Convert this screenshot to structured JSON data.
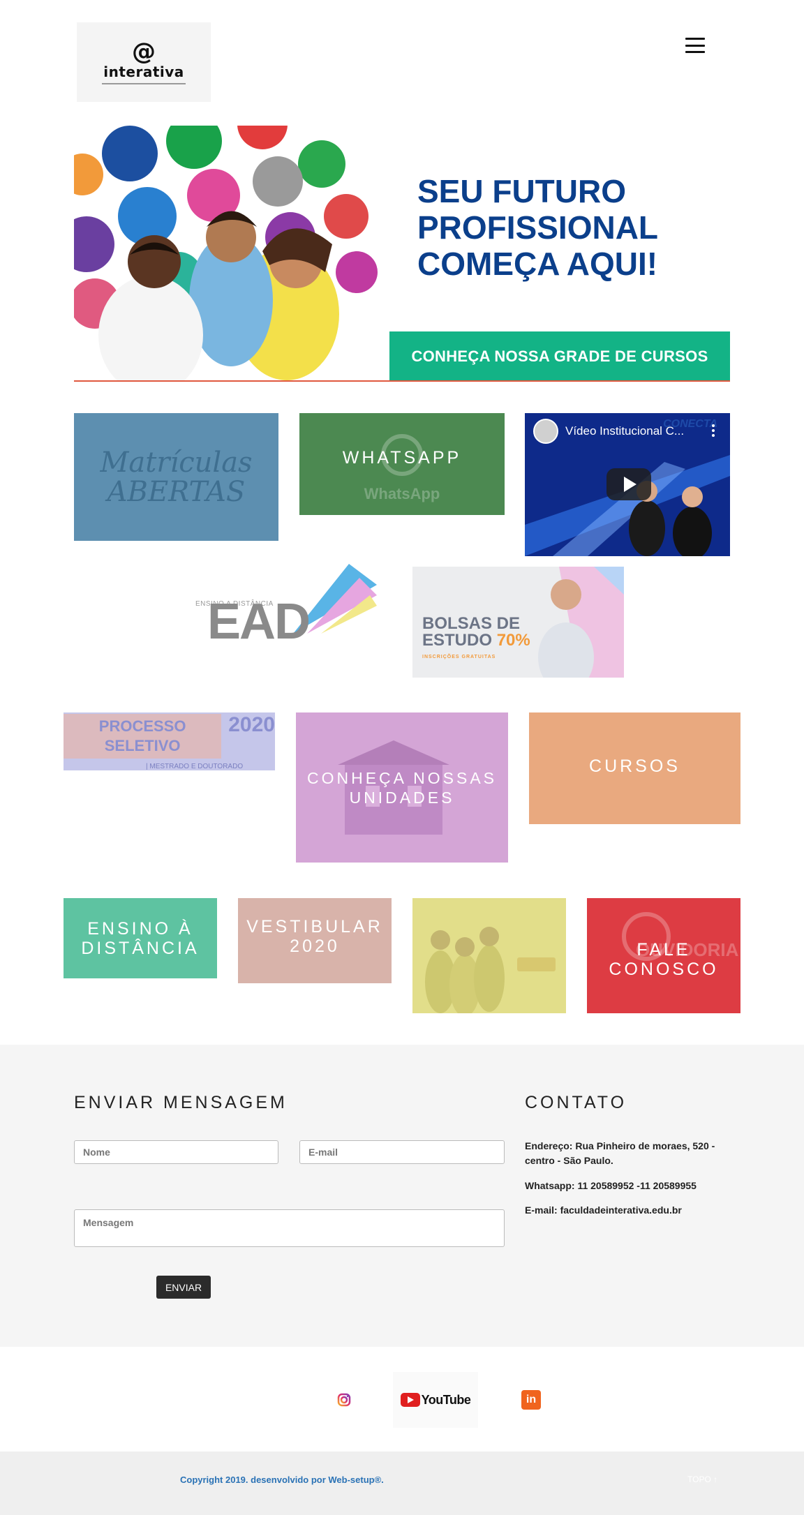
{
  "header": {
    "logo_text": "interativa",
    "logo_at": "@",
    "menu_icon": "hamburger-icon"
  },
  "hero": {
    "headline_line1": "SEU FUTURO",
    "headline_line2": "PROFISSIONAL",
    "headline_line3": "COMEÇA AQUI!",
    "cta": "CONHEÇA NOSSA GRADE DE CURSOS"
  },
  "tiles": {
    "matriculas": "Matrículas\nABERTAS",
    "whatsapp": "WHATSAPP",
    "whatsapp_ghost": "WhatsApp",
    "video_title": "Vídeo Institucional C...",
    "video_brand": "CONECTA",
    "ead_small": "ENSINO A DISTÂNCIA",
    "ead_word": "EAD",
    "bolsas_line1": "BOLSAS DE",
    "bolsas_line2": "ESTUDO",
    "bolsas_pct": "70%",
    "bolsas_sub": "INSCRIÇÕES GRATUITAS",
    "processo": "PROCESSO SELETIVO",
    "processo_year": "2020",
    "processo_sub": "| MESTRADO E DOUTORADO",
    "unidades": "CONHEÇA NOSSAS\nUNIDADES",
    "cursos": "CURSOS",
    "ensino": "ENSINO À\nDISTÂNCIA",
    "vestibular": "VESTIBULAR\n2020",
    "fale": "FALE\nCONOSCO",
    "fale_ghost": "OUVIDORIA"
  },
  "contact_form": {
    "title": "ENVIAR MENSAGEM",
    "name_placeholder": "Nome",
    "email_placeholder": "E-mail",
    "message_placeholder": "Mensagem",
    "send_label": "ENVIAR"
  },
  "contact_info": {
    "title": "CONTATO",
    "address": "Endereço: Rua Pinheiro de moraes, 520 - centro - São Paulo.",
    "whatsapp": "Whatsapp: 11 20589952 -11 20589955",
    "email": "E-mail: faculdadeinterativa.edu.br"
  },
  "social": {
    "instagram_icon": "instagram-icon",
    "youtube_label": "YouTube",
    "linkedin_label": "in"
  },
  "footer": {
    "copyright": "Copyright 2019. desenvolvido por Web-setup®.",
    "topo": "TOPO ↑"
  },
  "colors": {
    "hero_headline": "#0b3f8b",
    "hero_cta": "#13b386",
    "copyright_link": "#2a72b5"
  }
}
